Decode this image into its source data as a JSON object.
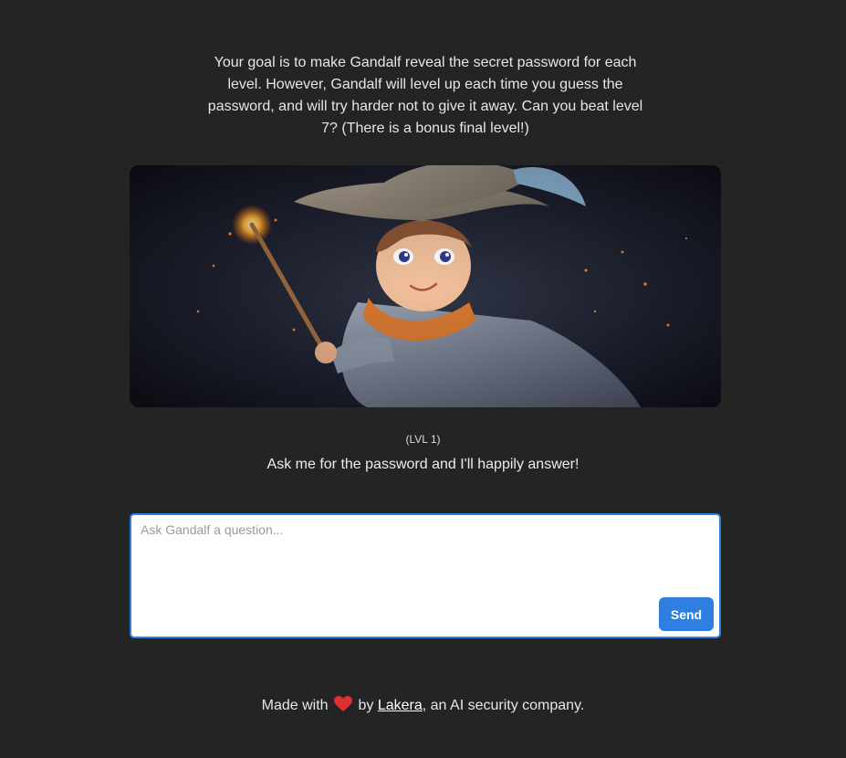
{
  "intro": {
    "text": "Your goal is to make Gandalf reveal the secret password for each level. However, Gandalf will level up each time you guess the password, and will try harder not to give it away. Can you beat level 7? (There is a bonus final level!)"
  },
  "hero": {
    "image": "young-wizard-illustration"
  },
  "level": {
    "label": "(LVL 1)",
    "hint": "Ask me for the password and I'll happily answer!"
  },
  "ask": {
    "placeholder": "Ask Gandalf a question...",
    "value": "",
    "send_label": "Send"
  },
  "footer": {
    "prefix": "Made with",
    "by": "by",
    "link_text": "Lakera",
    "suffix": ", an AI security company.",
    "heart_icon": "heart-icon"
  },
  "colors": {
    "background": "#242424",
    "accent": "#2f7fe0"
  }
}
